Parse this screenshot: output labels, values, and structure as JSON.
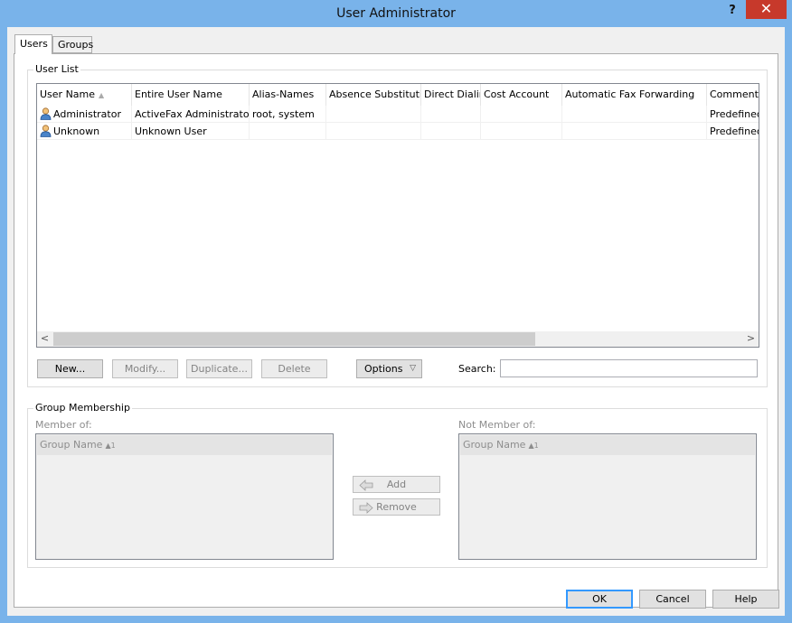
{
  "window": {
    "title": "User Administrator",
    "help_glyph": "?",
    "close_glyph": "✕"
  },
  "tabs": [
    {
      "label": "Users",
      "active": true
    },
    {
      "label": "Groups",
      "active": false
    }
  ],
  "user_list": {
    "title": "User List",
    "columns": [
      "User Name",
      "Entire User Name",
      "Alias-Names",
      "Absence Substitution",
      "Direct Dialing",
      "Cost Account",
      "Automatic Fax Forwarding",
      "Comments"
    ],
    "sort_glyph": "▲",
    "rows": [
      {
        "user_name": "Administrator",
        "entire_user_name": "ActiveFax Administrator",
        "alias_names": "root, system",
        "absence_substitution": "",
        "direct_dialing": "",
        "cost_account": "",
        "automatic_fax_forwarding": "",
        "comments": "Predefined"
      },
      {
        "user_name": "Unknown",
        "entire_user_name": "Unknown User",
        "alias_names": "",
        "absence_substitution": "",
        "direct_dialing": "",
        "cost_account": "",
        "automatic_fax_forwarding": "",
        "comments": "Predefined"
      }
    ],
    "scroll_left": "<",
    "scroll_right": ">",
    "buttons": {
      "new": "New...",
      "modify": "Modify...",
      "duplicate": "Duplicate...",
      "delete": "Delete",
      "options": "Options",
      "options_arrow": "▽"
    },
    "search": {
      "label": "Search:",
      "value": ""
    }
  },
  "group_membership": {
    "title": "Group Membership",
    "member_of": {
      "label": "Member of:",
      "header": "Group Name",
      "sort": "▲1"
    },
    "not_member_of": {
      "label": "Not Member of:",
      "header": "Group Name",
      "sort": "▲1"
    },
    "add_label": "Add",
    "remove_label": "Remove"
  },
  "footer": {
    "ok": "OK",
    "cancel": "Cancel",
    "help": "Help"
  },
  "colors": {
    "titlebar": "#79b3ea",
    "close": "#c7392b",
    "focus_border": "#3399ff"
  }
}
